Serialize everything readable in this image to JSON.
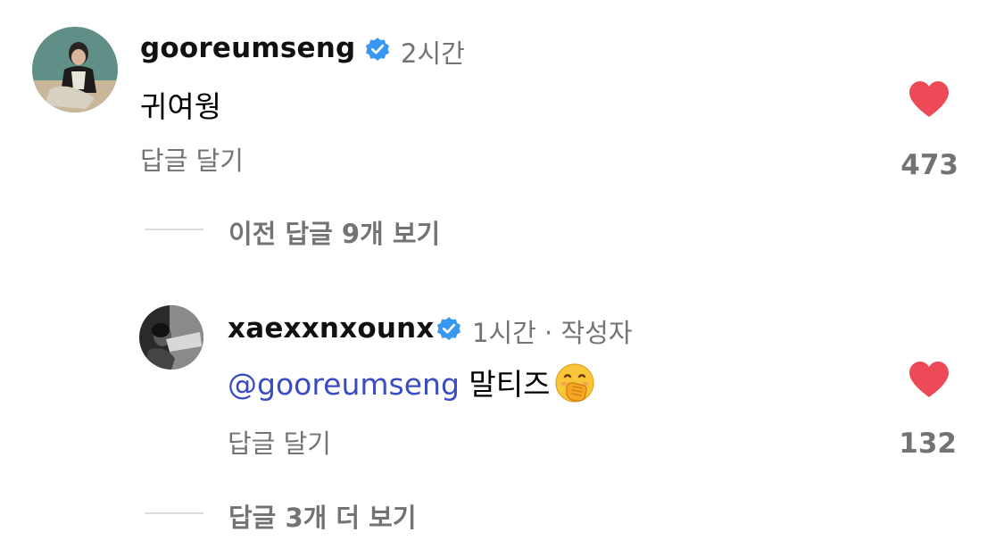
{
  "comment": {
    "username": "gooreumseng",
    "time": "2시간",
    "text": "귀여웡",
    "reply_label": "답글 달기",
    "likes": "473",
    "view_previous": "이전 답글 9개 보기"
  },
  "reply": {
    "username": "xaexxnxounx",
    "time": "1시간 · 작성자",
    "mention": "@gooreumseng",
    "text": "말티즈",
    "emoji": "face-with-hand-over-mouth",
    "reply_label": "답글 달기",
    "likes": "132",
    "view_more": "답글 3개 더 보기"
  },
  "colors": {
    "heart": "#ed4956",
    "verified": "#3897f0",
    "mention": "#3b4cc0",
    "muted": "#737373"
  },
  "icons": {
    "verified": "verified-badge-icon",
    "like": "heart-icon"
  }
}
